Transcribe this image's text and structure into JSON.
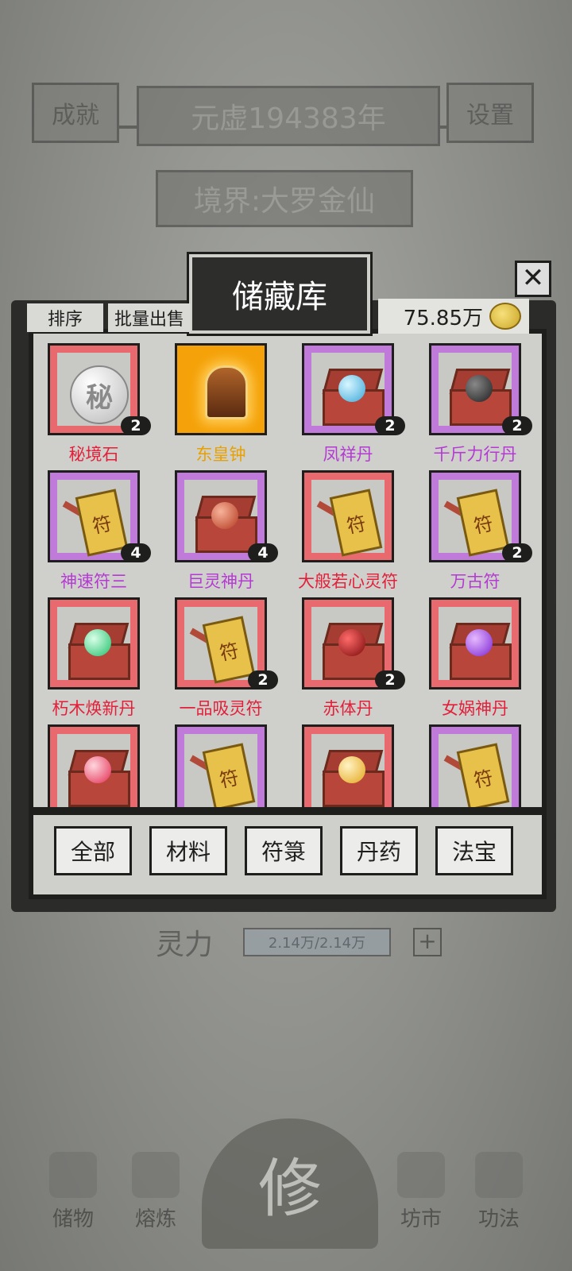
{
  "header": {
    "achievement_label": "成就",
    "year_text": "元虚194383年",
    "settings_label": "设置",
    "realm_text": "境界:大罗金仙"
  },
  "storage": {
    "title": "储藏库",
    "sort_label": "排序",
    "batch_sell_label": "批量出售",
    "currency": "75.85万",
    "close_label": "✕",
    "items": [
      {
        "name": "秘境石",
        "rarity": "red",
        "icon": "secret-stone-icon",
        "count": "2"
      },
      {
        "name": "东皇钟",
        "rarity": "gold",
        "icon": "bell-icon",
        "count": ""
      },
      {
        "name": "凤祥丹",
        "rarity": "purple",
        "icon": "blue-pill-chest-icon",
        "count": "2"
      },
      {
        "name": "千斤力行丹",
        "rarity": "purple",
        "icon": "black-pill-chest-icon",
        "count": "2"
      },
      {
        "name": "神速符三",
        "rarity": "purple",
        "icon": "talisman-icon",
        "count": "4"
      },
      {
        "name": "巨灵神丹",
        "rarity": "purple",
        "icon": "red-pill-chest-icon",
        "count": "4"
      },
      {
        "name": "大般若心灵符",
        "rarity": "red",
        "icon": "talisman-icon",
        "count": ""
      },
      {
        "name": "万古符",
        "rarity": "purple",
        "icon": "talisman-icon",
        "count": "2"
      },
      {
        "name": "朽木焕新丹",
        "rarity": "red",
        "icon": "green-pill-chest-icon",
        "count": ""
      },
      {
        "name": "一品吸灵符",
        "rarity": "red",
        "icon": "talisman-icon",
        "count": "2"
      },
      {
        "name": "赤体丹",
        "rarity": "red",
        "icon": "crimson-pill-chest-icon",
        "count": "2"
      },
      {
        "name": "女娲神丹",
        "rarity": "red",
        "icon": "purple-pill-chest-icon",
        "count": ""
      },
      {
        "name": "",
        "rarity": "red",
        "icon": "pink-pill-chest-icon",
        "count": ""
      },
      {
        "name": "",
        "rarity": "purple",
        "icon": "talisman-icon",
        "count": ""
      },
      {
        "name": "",
        "rarity": "red",
        "icon": "gold-pill-chest-icon",
        "count": ""
      },
      {
        "name": "",
        "rarity": "purple",
        "icon": "talisman-icon",
        "count": ""
      }
    ],
    "tabs": [
      "全部",
      "材料",
      "符箓",
      "丹药",
      "法宝"
    ]
  },
  "stats": {
    "spirit_label": "灵力",
    "spirit_value": "2.14万/2.14万",
    "plus_label": "+"
  },
  "nav": {
    "storage": "储物",
    "smelt": "熔炼",
    "cultivate": "修",
    "market": "坊市",
    "skills": "功法"
  },
  "colors": {
    "red": "#e86a6e",
    "purple": "#c07ad9",
    "gold": "#f5a20a"
  }
}
